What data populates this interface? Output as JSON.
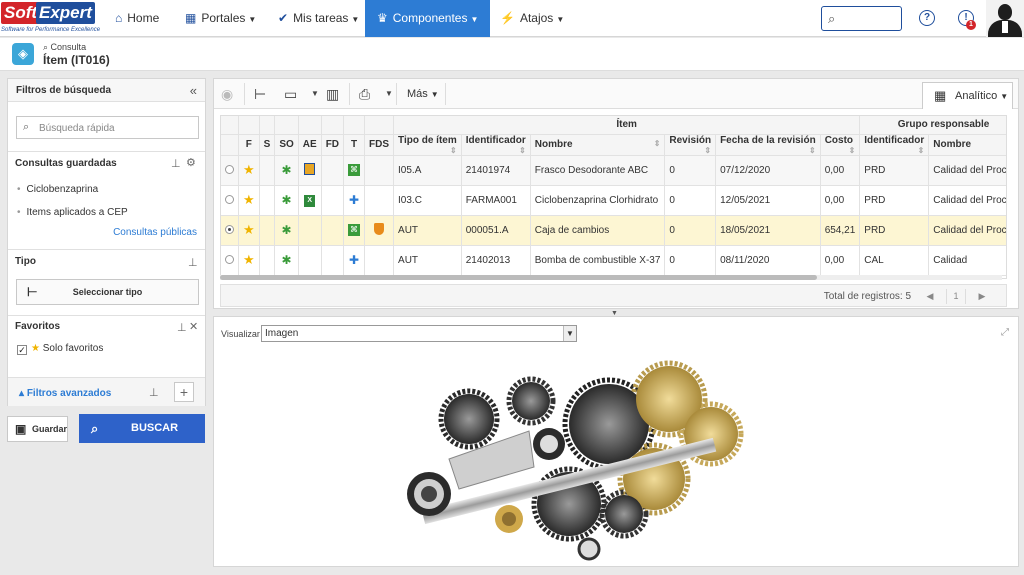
{
  "brand": {
    "part1": "Soft",
    "part2": "Expert",
    "tagline": "Software for Performance Excellence"
  },
  "nav": [
    {
      "label": "Home",
      "icon": "home-icon",
      "glyph": "⌂"
    },
    {
      "label": "Portales",
      "icon": "portal-icon",
      "glyph": "▦"
    },
    {
      "label": "Mis tareas",
      "icon": "check-icon",
      "glyph": "✔"
    },
    {
      "label": "Componentes",
      "icon": "trophy-icon",
      "glyph": "♛"
    },
    {
      "label": "Atajos",
      "icon": "bolt-icon",
      "glyph": "⚡"
    }
  ],
  "notifications": {
    "count": "1"
  },
  "subheader": {
    "small": "Consulta",
    "title": "Ítem (IT016)"
  },
  "filters": {
    "title": "Filtros de búsqueda",
    "quick_search_placeholder": "Búsqueda rápida",
    "saved_title": "Consultas guardadas",
    "saved_items": [
      "Ciclobenzaprina",
      "Items aplicados a CEP"
    ],
    "public_link": "Consultas públicas",
    "tipo_title": "Tipo",
    "tipo_button": "Seleccionar tipo",
    "fav_title": "Favoritos",
    "fav_only": "Solo favoritos",
    "advanced": "Filtros avanzados"
  },
  "buttons": {
    "save": "Guardar",
    "search": "BUSCAR"
  },
  "toolbar": {
    "more": "Más",
    "view": "Analítico"
  },
  "grid": {
    "group_item": "Ítem",
    "group_resp": "Grupo responsable",
    "flag_headers": [
      "F",
      "S",
      "SO",
      "AE",
      "FD",
      "T",
      "FDS"
    ],
    "columns": [
      "Tipo de ítem",
      "Identificador",
      "Nombre",
      "Revisión",
      "Fecha de la revisión",
      "Costo",
      "Identificador",
      "Nombre"
    ],
    "rows": [
      {
        "tipo": "I05.A",
        "id": "21401974",
        "nombre": "Frasco Desodorante ABC",
        "rev": "0",
        "fecha": "07/12/2020",
        "costo": "0,00",
        "gid": "PRD",
        "gnombre": "Calidad del Proceso",
        "selected": false
      },
      {
        "tipo": "I03.C",
        "id": "FARMA001",
        "nombre": "Ciclobenzaprina Clorhidrato",
        "rev": "0",
        "fecha": "12/05/2021",
        "costo": "0,00",
        "gid": "PRD",
        "gnombre": "Calidad del Proceso",
        "selected": false
      },
      {
        "tipo": "AUT",
        "id": "000051.A",
        "nombre": "Caja de cambios",
        "rev": "0",
        "fecha": "18/05/2021",
        "costo": "654,21",
        "gid": "PRD",
        "gnombre": "Calidad del Proceso",
        "selected": true
      },
      {
        "tipo": "AUT",
        "id": "21402013",
        "nombre": "Bomba de combustible X-37",
        "rev": "0",
        "fecha": "08/11/2020",
        "costo": "0,00",
        "gid": "CAL",
        "gnombre": "Calidad",
        "selected": false
      }
    ],
    "total": "Total de registros: 5",
    "page": "1"
  },
  "viewer": {
    "label": "Visualizar",
    "value": "Imagen"
  }
}
